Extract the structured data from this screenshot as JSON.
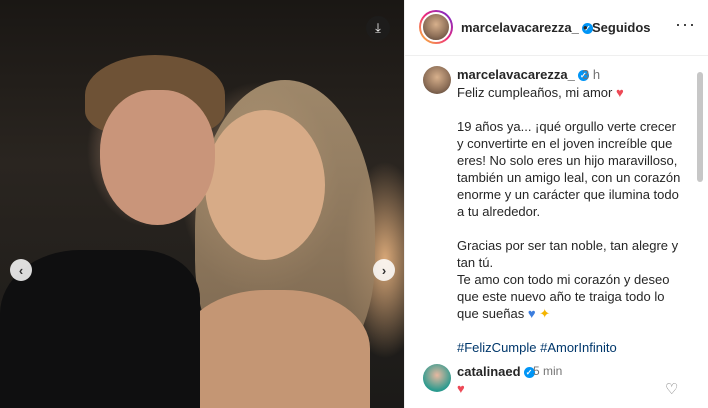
{
  "post": {
    "author": "marcelavacarezza_",
    "follow_status": "Seguidos",
    "time": "3 h",
    "caption_lines": [
      "Feliz cumpleaños, mi amor",
      "",
      "19 años ya... ¡qué orgullo verte crecer y convertirte en el joven increíble que eres! No solo eres un hijo maravilloso, también un amigo leal, con un corazón enorme y un carácter que ilumina todo a tu alrededor.",
      "",
      "Gracias por ser tan noble, tan alegre y tan tú.",
      "Te amo con todo mi corazón y deseo que este nuevo año te traiga todo lo que sueñas"
    ],
    "hashtags": "#FelizCumple #AmorInfinito"
  },
  "comment": {
    "author": "catalinaed",
    "time": "5 min",
    "text": "♥"
  },
  "icons": {
    "download": "download-icon",
    "prev": "chevron-left-icon",
    "next": "chevron-right-icon",
    "verified": "verified-badge-icon",
    "more": "more-options-icon",
    "like": "heart-outline-icon"
  },
  "colors": {
    "verified": "#0095f6",
    "heart": "#ed4956",
    "hashtag": "#00376b"
  }
}
